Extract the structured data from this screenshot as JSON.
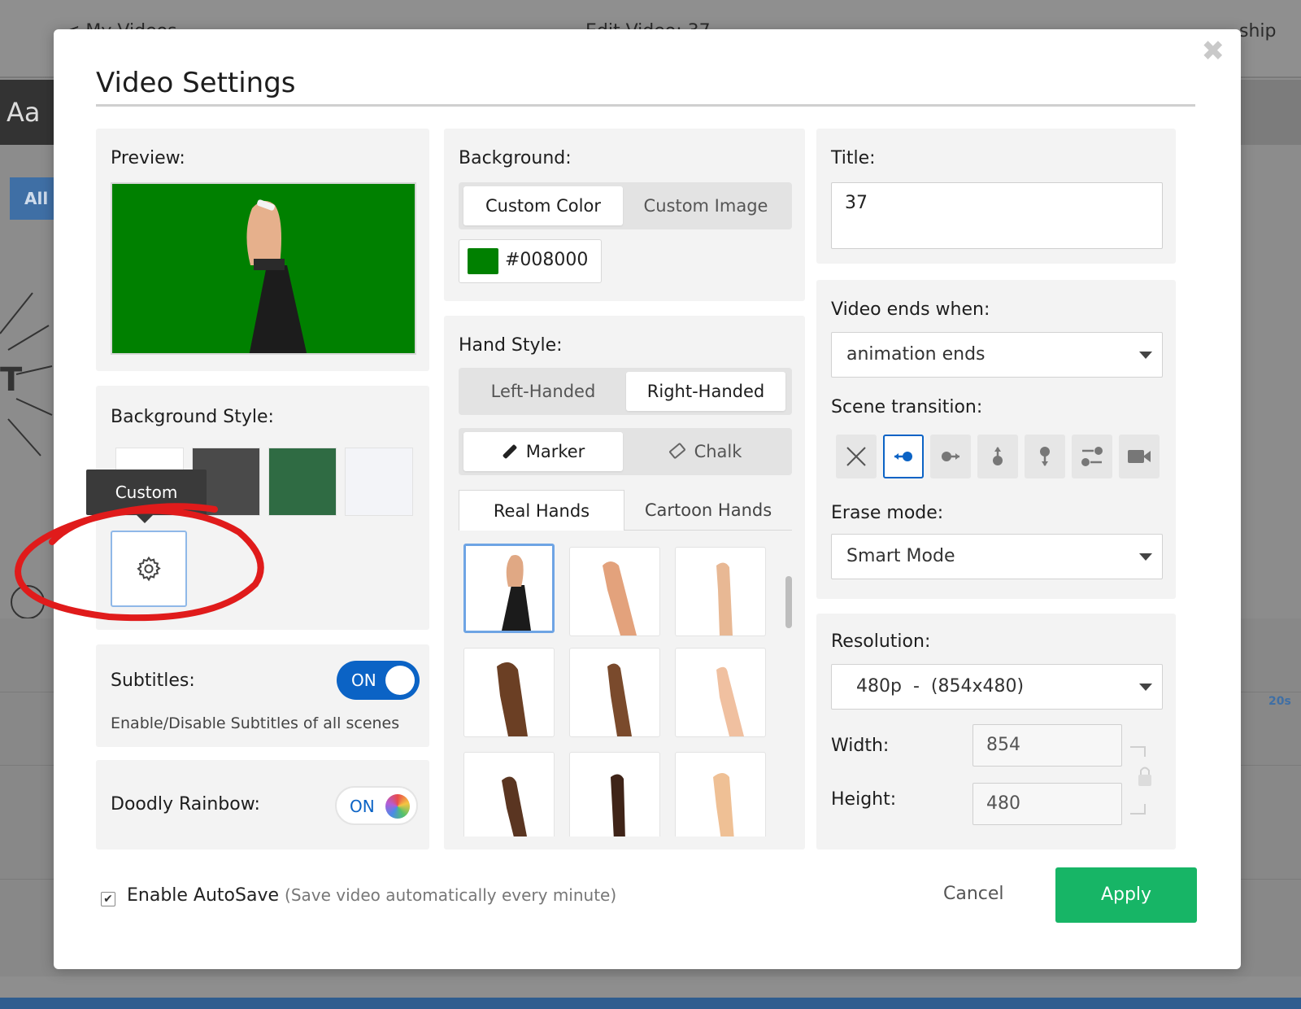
{
  "background_app": {
    "tab_partial_left": "< My Videos",
    "tab_partial_center": "Edit Video: 37",
    "tab_partial_right": "ship",
    "aa_label": "Aa",
    "all_label": "All",
    "timeline_marker": "20s"
  },
  "modal": {
    "title": "Video Settings",
    "close_symbol": "✖"
  },
  "preview": {
    "label": "Preview:"
  },
  "background_style": {
    "label": "Background Style:",
    "tooltip": "Custom"
  },
  "subtitles": {
    "label": "Subtitles:",
    "toggle_text": "ON",
    "description": "Enable/Disable Subtitles of all scenes"
  },
  "doodly_rainbow": {
    "label": "Doodly Rainbow:",
    "toggle_text": "ON"
  },
  "background": {
    "label": "Background:",
    "options": [
      "Custom Color",
      "Custom Image"
    ],
    "selected": "Custom Color",
    "color_value": "#008000"
  },
  "hand_style": {
    "label": "Hand Style:",
    "handedness": [
      "Left-Handed",
      "Right-Handed"
    ],
    "handedness_selected": "Right-Handed",
    "tool": [
      "Marker",
      "Chalk"
    ],
    "tool_selected": "Marker",
    "tabs": [
      "Real Hands",
      "Cartoon Hands"
    ],
    "tab_selected": "Real Hands",
    "hand_colors": [
      "#1b1b1b",
      "#e3a27c",
      "#e8b894",
      "#6b3f24",
      "#7a4a2c",
      "#f0c0a0",
      "#5a3521",
      "#3f2418",
      "#efc095"
    ]
  },
  "title_field": {
    "label": "Title:",
    "value": "37"
  },
  "video_ends": {
    "label": "Video ends when:",
    "value": "animation ends"
  },
  "scene_transition": {
    "label": "Scene transition:",
    "icons": [
      "none-x-icon",
      "slide-left-icon",
      "slide-right-icon",
      "slide-up-icon",
      "slide-down-icon",
      "swap-icon",
      "camera-icon"
    ],
    "selected_index": 1
  },
  "erase_mode": {
    "label": "Erase mode:",
    "value": "Smart Mode"
  },
  "resolution": {
    "label": "Resolution:",
    "value": "480p  -  (854x480)",
    "width_label": "Width:",
    "width_value": "854",
    "height_label": "Height:",
    "height_value": "480"
  },
  "footer": {
    "autosave_label": "Enable AutoSave",
    "autosave_hint": "(Save video automatically every minute)",
    "autosave_checked": true,
    "cancel": "Cancel",
    "apply": "Apply"
  },
  "colors": {
    "accent_blue": "#0b63c5",
    "apply_green": "#17b566",
    "highlight_red": "#e01b1b",
    "preview_green": "#008000"
  }
}
